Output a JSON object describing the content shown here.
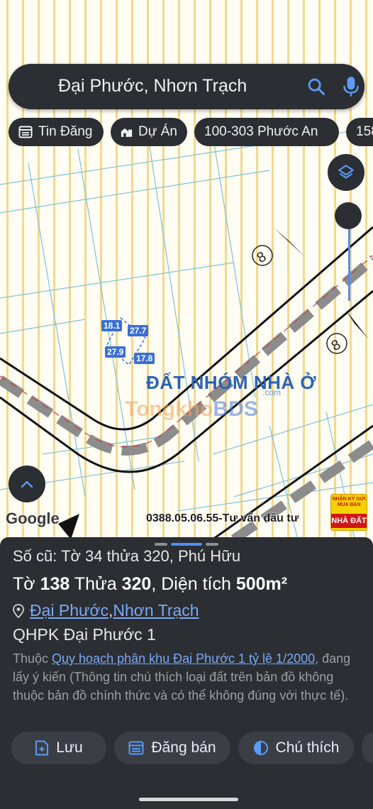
{
  "search": {
    "query": "Đại Phước, Nhơn Trạch"
  },
  "chips": [
    {
      "label": "Tin Đăng",
      "icon": "listing-icon"
    },
    {
      "label": "Dự Án",
      "icon": "building-icon"
    },
    {
      "label": "100-303 Phước An"
    },
    {
      "label": "158"
    }
  ],
  "map": {
    "lot_dimensions": [
      "18.1",
      "27.7",
      "27.9",
      "17.8"
    ],
    "zone_label": "ĐẤT NHÓM NHÀ Ở",
    "watermark_com": ".com",
    "watermark_brand_a": "Tongkho",
    "watermark_brand_b": "BDS",
    "google_attribution": "Google",
    "contact_watermark": "0388.05.06.55-Tư vấn đầu tư",
    "badge_top": "NHẬN KÝ GỬI MUA BÁN",
    "badge_bottom": "NHÀ ĐẤT",
    "lot_number_marks": [
      "8",
      "8"
    ]
  },
  "sheet": {
    "old_parcel": "Số cũ: Tờ 34 thửa 320, Phú Hữu",
    "parcel_prefix": "Tờ ",
    "sheet_number": "138",
    "parcel_mid": " Thửa ",
    "parcel_number": "320",
    "area_label": ", Diện tích ",
    "area_value": "500m²",
    "ward": "Đại Phước",
    "separator": ", ",
    "district": "Nhơn Trạch",
    "plan_name": "QHPK Đại Phước 1",
    "desc_prefix": "Thuộc ",
    "desc_link": "Quy hoạch phân khu Đại Phước 1 tỷ lệ 1/2000",
    "desc_rest": ", đang lấy ý kiến (Thông tin chú thích loại đất trên bản đồ không thuộc bản đồ chính thức và có thể không đúng với thực tế)."
  },
  "actions": [
    {
      "label": "Lưu",
      "icon": "save-icon"
    },
    {
      "label": "Đăng bán",
      "icon": "post-sale-icon"
    },
    {
      "label": "Chú thích",
      "icon": "legend-icon"
    }
  ],
  "colors": {
    "sheet_bg": "#2b2e33",
    "link": "#7aa9f5",
    "accent_blue": "#4d8ef5",
    "map_stripe": "#f3d98b"
  }
}
